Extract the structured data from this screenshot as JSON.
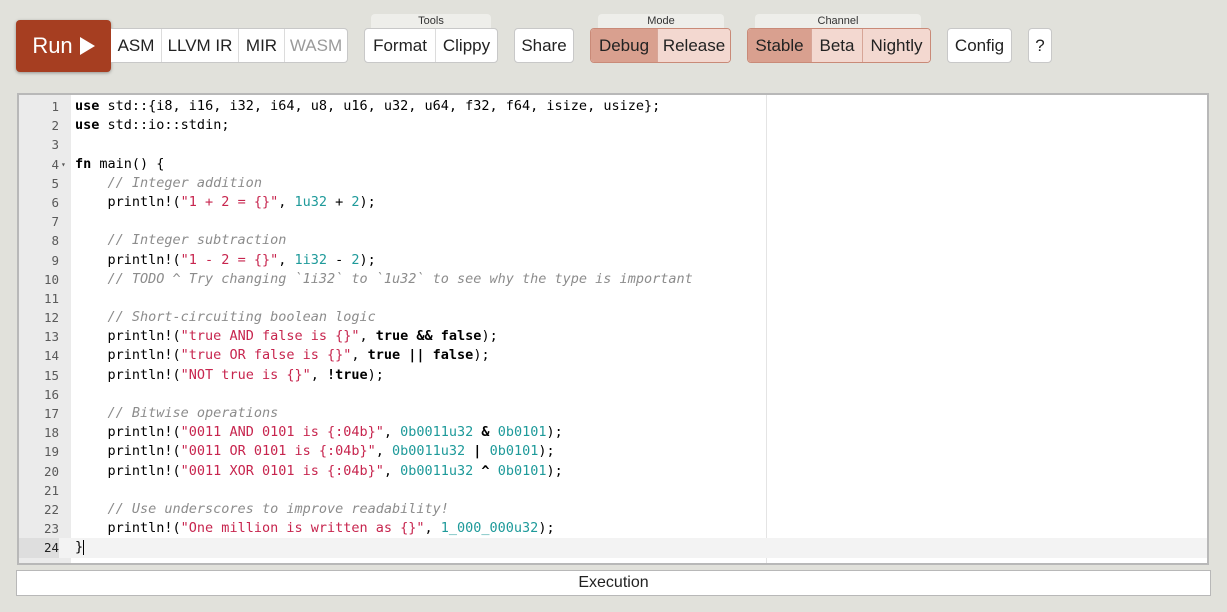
{
  "toolbar": {
    "run_label": "Run",
    "build_targets": [
      "ASM",
      "LLVM IR",
      "MIR",
      "WASM"
    ],
    "tools_label": "Tools",
    "tools": [
      "Format",
      "Clippy"
    ],
    "share_label": "Share",
    "mode_label": "Mode",
    "modes": [
      "Debug",
      "Release"
    ],
    "mode_selected": "Debug",
    "channel_label": "Channel",
    "channels": [
      "Stable",
      "Beta",
      "Nightly"
    ],
    "channel_selected": "Stable",
    "config_label": "Config",
    "help_label": "?"
  },
  "editor": {
    "active_line": 24,
    "line_numbers": [
      "1",
      "2",
      "3",
      "4",
      "5",
      "6",
      "7",
      "8",
      "9",
      "10",
      "11",
      "12",
      "13",
      "14",
      "15",
      "16",
      "17",
      "18",
      "19",
      "20",
      "21",
      "22",
      "23",
      "24"
    ],
    "lines": [
      [
        [
          "kw",
          "use"
        ],
        [
          "",
          "std::{i8, i16, i32, i64, u8, u16, u32, u64, f32, f64, isize, usize};"
        ]
      ],
      [
        [
          "kw",
          "use"
        ],
        [
          "",
          "std::io::stdin;"
        ]
      ],
      [],
      [
        [
          "kw",
          "fn"
        ],
        [
          "",
          " main() {"
        ]
      ],
      [
        [
          "",
          "    "
        ],
        [
          "cm",
          "// Integer addition"
        ]
      ],
      [
        [
          "",
          "    println!("
        ],
        [
          "st",
          "\"1 + 2 = {}\""
        ],
        [
          "",
          ", "
        ],
        [
          "nu",
          "1u32"
        ],
        [
          "",
          " + "
        ],
        [
          "nu",
          "2"
        ],
        [
          "",
          ");"
        ]
      ],
      [],
      [
        [
          "",
          "    "
        ],
        [
          "cm",
          "// Integer subtraction"
        ]
      ],
      [
        [
          "",
          "    println!("
        ],
        [
          "st",
          "\"1 - 2 = {}\""
        ],
        [
          "",
          ", "
        ],
        [
          "nu",
          "1i32"
        ],
        [
          "",
          " - "
        ],
        [
          "nu",
          "2"
        ],
        [
          "",
          ");"
        ]
      ],
      [
        [
          "",
          "    "
        ],
        [
          "cm",
          "// TODO ^ Try changing `1i32` to `1u32` to see why the type is important"
        ]
      ],
      [],
      [
        [
          "",
          "    "
        ],
        [
          "cm",
          "// Short-circuiting boolean logic"
        ]
      ],
      [
        [
          "",
          "    println!("
        ],
        [
          "st",
          "\"true AND false is {}\""
        ],
        [
          "",
          ", "
        ],
        [
          "kw",
          "true"
        ],
        [
          "op",
          " &&"
        ],
        [
          "kw",
          " false"
        ],
        [
          "",
          ");"
        ]
      ],
      [
        [
          "",
          "    println!("
        ],
        [
          "st",
          "\"true OR false is {}\""
        ],
        [
          "",
          ", "
        ],
        [
          "kw",
          "true"
        ],
        [
          "op",
          " ||"
        ],
        [
          "kw",
          " false"
        ],
        [
          "",
          ");"
        ]
      ],
      [
        [
          "",
          "    println!("
        ],
        [
          "st",
          "\"NOT true is {}\""
        ],
        [
          "",
          ", "
        ],
        [
          "op",
          "!"
        ],
        [
          "kw",
          "true"
        ],
        [
          "",
          ");"
        ]
      ],
      [],
      [
        [
          "",
          "    "
        ],
        [
          "cm",
          "// Bitwise operations"
        ]
      ],
      [
        [
          "",
          "    println!("
        ],
        [
          "st",
          "\"0011 AND 0101 is {:04b}\""
        ],
        [
          "",
          ", "
        ],
        [
          "nu",
          "0b0011u32"
        ],
        [
          "op",
          " &"
        ],
        [
          "",
          " "
        ],
        [
          "nu",
          "0b0101"
        ],
        [
          "",
          ");"
        ]
      ],
      [
        [
          "",
          "    println!("
        ],
        [
          "st",
          "\"0011 OR 0101 is {:04b}\""
        ],
        [
          "",
          ", "
        ],
        [
          "nu",
          "0b0011u32"
        ],
        [
          "op",
          " |"
        ],
        [
          "",
          " "
        ],
        [
          "nu",
          "0b0101"
        ],
        [
          "",
          ");"
        ]
      ],
      [
        [
          "",
          "    println!("
        ],
        [
          "st",
          "\"0011 XOR 0101 is {:04b}\""
        ],
        [
          "",
          ", "
        ],
        [
          "nu",
          "0b0011u32"
        ],
        [
          "op",
          " ^"
        ],
        [
          "",
          " "
        ],
        [
          "nu",
          "0b0101"
        ],
        [
          "",
          ");"
        ]
      ],
      [],
      [
        [
          "",
          "    "
        ],
        [
          "cm",
          "// Use underscores to improve readability!"
        ]
      ],
      [
        [
          "",
          "    println!("
        ],
        [
          "st",
          "\"One million is written as {}\""
        ],
        [
          "",
          ", "
        ],
        [
          "nu",
          "1_000_000u32"
        ],
        [
          "",
          ");"
        ]
      ],
      [
        [
          "",
          "}"
        ]
      ]
    ]
  },
  "output": {
    "execution_label": "Execution"
  }
}
